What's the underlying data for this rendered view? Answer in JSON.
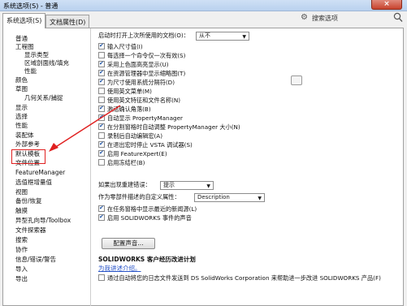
{
  "window": {
    "title": "系统选项(S) - 普通",
    "close_label": "×"
  },
  "tabs": [
    {
      "label": "系统选项(S)",
      "active": true
    },
    {
      "label": "文档属性(D)",
      "active": false
    }
  ],
  "search": {
    "label": "搜索选项"
  },
  "tree": {
    "items": [
      {
        "label": "普通"
      },
      {
        "label": "工程图"
      },
      {
        "label": "显示类型"
      },
      {
        "label": "区域剖面线/填充"
      },
      {
        "label": "性能"
      },
      {
        "label": "颜色"
      },
      {
        "label": "草图"
      },
      {
        "label": "几何关系/捕捉"
      },
      {
        "label": "显示"
      },
      {
        "label": "选择"
      },
      {
        "label": "性能"
      },
      {
        "label": "装配体"
      },
      {
        "label": "外部参考"
      },
      {
        "label": "默认模板"
      },
      {
        "label": "文件位置"
      },
      {
        "label": "FeatureManager"
      },
      {
        "label": "选值框增量值"
      },
      {
        "label": "视图"
      },
      {
        "label": "备份/恢复"
      },
      {
        "label": "触摸"
      },
      {
        "label": "异型孔向导/Toolbox"
      },
      {
        "label": "文件探索器"
      },
      {
        "label": "搜索"
      },
      {
        "label": "协作"
      },
      {
        "label": "信息/错误/警告"
      },
      {
        "label": "导入"
      },
      {
        "label": "导出"
      }
    ]
  },
  "general": {
    "open_last_doc_label": "启动时打开上次所使用的文档(O)：",
    "open_last_doc_value": "从不",
    "checkboxes": [
      {
        "label": "输入尺寸值(I)",
        "checked": true
      },
      {
        "label": "每选择一个命令仅一次有效(S)",
        "checked": false
      },
      {
        "label": "采用上色面高亮显示(U)",
        "checked": true
      },
      {
        "label": "在资源管理器中显示缩略图(T)",
        "checked": true
      },
      {
        "label": "为尺寸使用系统分隔符(D)",
        "checked": true
      },
      {
        "label": "使用英文菜单(M)",
        "checked": false
      },
      {
        "label": "使用英文特征和文件名称(N)",
        "checked": false
      },
      {
        "label": "激活确认角落(B)",
        "checked": true
      },
      {
        "label": "自动显示 PropertyManager",
        "checked": true
      },
      {
        "label": "在分割窗格时自动调整 PropertyManager 大小(N)",
        "checked": true
      },
      {
        "label": "录制后自动编辑宏(A)",
        "checked": false
      },
      {
        "label": "在退出宏时停止 VSTA 调试器(S)",
        "checked": true
      },
      {
        "label": "启用 FeatureXpert(E)",
        "checked": true
      },
      {
        "label": "启用冻结栏(B)",
        "checked": false
      }
    ],
    "rebuild_error_label": "如果出现重建错误：",
    "rebuild_error_value": "提示",
    "part_color_label": "作为零部件描述的自定义属性：",
    "part_color_value": "Description",
    "recent_docs_label": "在任务窗格中显示最近的新闻源(L)",
    "recent_docs_checked": true,
    "sounds_label": "启用 SOLIDWORKS 事件的声音",
    "sounds_checked": true,
    "configure_sounds_button": "配置声音...",
    "ceip_title": "SOLIDWORKS 客户经历改进计划",
    "ceip_link": "为我讲述介绍。",
    "ceip_checkbox_label": "通过自动将您的日志文件发送到 DS SolidWorks Corporation 来帮助进一步改进 SOLIDWORKS 产品(F)",
    "ceip_checked": false
  }
}
